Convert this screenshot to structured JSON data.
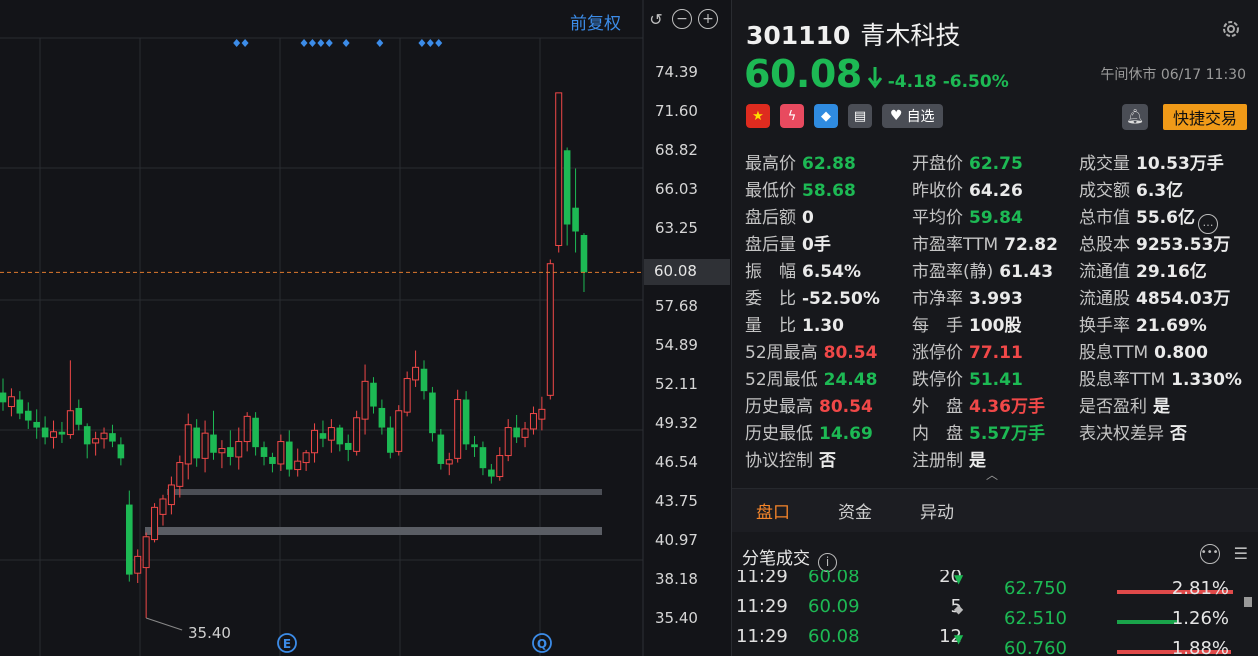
{
  "chart": {
    "fq_label": "前复权",
    "y_ticks": [
      "74.39",
      "71.60",
      "68.82",
      "66.03",
      "63.25",
      "60.08",
      "57.68",
      "54.89",
      "52.11",
      "49.32",
      "46.54",
      "43.75",
      "40.97",
      "38.18",
      "35.40"
    ],
    "current_price_label": "60.08",
    "low_annotation": "35.40",
    "marker_e": "E",
    "marker_q": "Q",
    "colors": {
      "up": "#f04848",
      "down": "#1db954",
      "grid": "#2a2c31",
      "current_line": "#e07a2e",
      "signal": "#3c8ce8"
    },
    "candles": [
      {
        "o": 51.5,
        "h": 52.5,
        "l": 50.2,
        "c": 50.8
      },
      {
        "o": 50.5,
        "h": 51.8,
        "l": 49.8,
        "c": 51.2
      },
      {
        "o": 51.0,
        "h": 51.6,
        "l": 49.6,
        "c": 50.0
      },
      {
        "o": 50.2,
        "h": 50.8,
        "l": 48.9,
        "c": 49.5
      },
      {
        "o": 49.4,
        "h": 50.3,
        "l": 48.2,
        "c": 49.0
      },
      {
        "o": 49.0,
        "h": 49.8,
        "l": 47.8,
        "c": 48.3
      },
      {
        "o": 48.3,
        "h": 49.5,
        "l": 47.5,
        "c": 48.7
      },
      {
        "o": 48.7,
        "h": 49.4,
        "l": 47.9,
        "c": 48.5
      },
      {
        "o": 48.5,
        "h": 53.8,
        "l": 48.2,
        "c": 50.2
      },
      {
        "o": 50.4,
        "h": 51.0,
        "l": 48.8,
        "c": 49.2
      },
      {
        "o": 49.1,
        "h": 49.3,
        "l": 46.8,
        "c": 47.8
      },
      {
        "o": 47.9,
        "h": 48.7,
        "l": 47.0,
        "c": 48.2
      },
      {
        "o": 48.2,
        "h": 49.0,
        "l": 47.5,
        "c": 48.6
      },
      {
        "o": 48.6,
        "h": 49.2,
        "l": 47.6,
        "c": 48.0
      },
      {
        "o": 47.8,
        "h": 48.3,
        "l": 46.3,
        "c": 46.8
      },
      {
        "o": 43.5,
        "h": 44.5,
        "l": 38.0,
        "c": 38.5
      },
      {
        "o": 38.6,
        "h": 40.3,
        "l": 37.9,
        "c": 39.8
      },
      {
        "o": 39.0,
        "h": 41.5,
        "l": 35.4,
        "c": 41.2
      },
      {
        "o": 41.0,
        "h": 43.6,
        "l": 40.8,
        "c": 43.3
      },
      {
        "o": 42.8,
        "h": 44.2,
        "l": 42.0,
        "c": 43.9
      },
      {
        "o": 43.5,
        "h": 45.5,
        "l": 42.8,
        "c": 44.9
      },
      {
        "o": 44.8,
        "h": 47.0,
        "l": 44.0,
        "c": 46.5
      },
      {
        "o": 46.4,
        "h": 50.0,
        "l": 45.3,
        "c": 49.2
      },
      {
        "o": 49.0,
        "h": 49.6,
        "l": 46.2,
        "c": 46.8
      },
      {
        "o": 46.8,
        "h": 49.5,
        "l": 45.8,
        "c": 48.6
      },
      {
        "o": 48.5,
        "h": 50.2,
        "l": 46.7,
        "c": 47.2
      },
      {
        "o": 47.2,
        "h": 48.1,
        "l": 46.1,
        "c": 47.5
      },
      {
        "o": 47.6,
        "h": 48.8,
        "l": 46.3,
        "c": 46.9
      },
      {
        "o": 46.9,
        "h": 49.0,
        "l": 46.0,
        "c": 48.0
      },
      {
        "o": 48.0,
        "h": 50.1,
        "l": 47.3,
        "c": 49.8
      },
      {
        "o": 49.7,
        "h": 50.1,
        "l": 47.0,
        "c": 47.6
      },
      {
        "o": 47.6,
        "h": 48.0,
        "l": 46.3,
        "c": 46.9
      },
      {
        "o": 46.9,
        "h": 47.2,
        "l": 45.8,
        "c": 46.4
      },
      {
        "o": 46.4,
        "h": 48.5,
        "l": 45.9,
        "c": 48.0
      },
      {
        "o": 48.0,
        "h": 48.8,
        "l": 45.5,
        "c": 46.0
      },
      {
        "o": 46.0,
        "h": 47.5,
        "l": 45.5,
        "c": 46.6
      },
      {
        "o": 46.5,
        "h": 47.4,
        "l": 45.9,
        "c": 47.2
      },
      {
        "o": 47.2,
        "h": 49.3,
        "l": 46.5,
        "c": 48.8
      },
      {
        "o": 48.6,
        "h": 49.5,
        "l": 47.6,
        "c": 48.2
      },
      {
        "o": 48.1,
        "h": 49.6,
        "l": 47.2,
        "c": 49.0
      },
      {
        "o": 49.0,
        "h": 49.2,
        "l": 47.3,
        "c": 47.8
      },
      {
        "o": 47.9,
        "h": 48.5,
        "l": 46.6,
        "c": 47.4
      },
      {
        "o": 47.3,
        "h": 50.2,
        "l": 47.0,
        "c": 49.7
      },
      {
        "o": 49.6,
        "h": 53.5,
        "l": 48.5,
        "c": 52.3
      },
      {
        "o": 52.2,
        "h": 52.6,
        "l": 50.0,
        "c": 50.5
      },
      {
        "o": 50.4,
        "h": 51.0,
        "l": 48.5,
        "c": 49.0
      },
      {
        "o": 49.0,
        "h": 49.8,
        "l": 46.8,
        "c": 47.2
      },
      {
        "o": 47.3,
        "h": 50.6,
        "l": 47.0,
        "c": 50.2
      },
      {
        "o": 50.1,
        "h": 53.0,
        "l": 49.8,
        "c": 52.5
      },
      {
        "o": 52.4,
        "h": 54.5,
        "l": 51.9,
        "c": 53.3
      },
      {
        "o": 53.2,
        "h": 53.8,
        "l": 51.0,
        "c": 51.6
      },
      {
        "o": 51.5,
        "h": 51.9,
        "l": 48.0,
        "c": 48.6
      },
      {
        "o": 48.5,
        "h": 48.9,
        "l": 46.0,
        "c": 46.4
      },
      {
        "o": 46.4,
        "h": 47.2,
        "l": 45.6,
        "c": 46.7
      },
      {
        "o": 46.8,
        "h": 51.7,
        "l": 46.5,
        "c": 51.0
      },
      {
        "o": 51.0,
        "h": 51.6,
        "l": 47.4,
        "c": 47.8
      },
      {
        "o": 47.8,
        "h": 48.4,
        "l": 46.9,
        "c": 47.6
      },
      {
        "o": 47.6,
        "h": 48.0,
        "l": 45.6,
        "c": 46.1
      },
      {
        "o": 46.0,
        "h": 46.4,
        "l": 45.0,
        "c": 45.5
      },
      {
        "o": 45.5,
        "h": 47.6,
        "l": 45.2,
        "c": 47.0
      },
      {
        "o": 47.0,
        "h": 49.6,
        "l": 46.6,
        "c": 49.0
      },
      {
        "o": 49.0,
        "h": 49.9,
        "l": 47.9,
        "c": 48.3
      },
      {
        "o": 48.3,
        "h": 49.4,
        "l": 47.6,
        "c": 48.9
      },
      {
        "o": 48.9,
        "h": 50.5,
        "l": 48.5,
        "c": 50.0
      },
      {
        "o": 49.6,
        "h": 51.2,
        "l": 48.8,
        "c": 50.3
      },
      {
        "o": 51.3,
        "h": 61.0,
        "l": 51.0,
        "c": 60.7
      },
      {
        "o": 62.0,
        "h": 72.9,
        "l": 61.5,
        "c": 72.9
      },
      {
        "o": 68.8,
        "h": 69.0,
        "l": 62.0,
        "c": 63.5
      },
      {
        "o": 64.7,
        "h": 67.5,
        "l": 61.5,
        "c": 63.0
      },
      {
        "o": 62.75,
        "h": 62.88,
        "l": 58.68,
        "c": 60.08
      }
    ],
    "signal_markers": [
      23,
      24,
      31,
      32,
      33,
      34,
      36,
      40,
      45,
      46,
      47
    ]
  },
  "stock": {
    "code": "301110",
    "name": "青木科技",
    "price": "60.08",
    "change": "-4.18",
    "change_pct": "-6.50%",
    "status": "午间休市 06/17 11:30",
    "fav_label": "自选",
    "quick_trade": "快捷交易",
    "stats": [
      {
        "label": "最高价",
        "value": "62.88",
        "color": "green"
      },
      {
        "label": "开盘价",
        "value": "62.75",
        "color": "green"
      },
      {
        "label": "成交量",
        "value": "10.53万手",
        "color": ""
      },
      {
        "label": "最低价",
        "value": "58.68",
        "color": "green"
      },
      {
        "label": "昨收价",
        "value": "64.26",
        "color": ""
      },
      {
        "label": "成交额",
        "value": "6.3亿",
        "color": ""
      },
      {
        "label": "盘后额",
        "value": "0",
        "color": ""
      },
      {
        "label": "平均价",
        "value": "59.84",
        "color": "green"
      },
      {
        "label": "总市值",
        "value": "55.6亿",
        "color": ""
      },
      {
        "label": "盘后量",
        "value": "0手",
        "color": ""
      },
      {
        "label": "市盈率TTM",
        "value": "72.82",
        "color": ""
      },
      {
        "label": "总股本",
        "value": "9253.53万",
        "color": ""
      },
      {
        "label": "振　幅",
        "value": "6.54%",
        "color": ""
      },
      {
        "label": "市盈率(静)",
        "value": "61.43",
        "color": ""
      },
      {
        "label": "流通值",
        "value": "29.16亿",
        "color": ""
      },
      {
        "label": "委　比",
        "value": "-52.50%",
        "color": ""
      },
      {
        "label": "市净率",
        "value": "3.993",
        "color": ""
      },
      {
        "label": "流通股",
        "value": "4854.03万",
        "color": ""
      },
      {
        "label": "量　比",
        "value": "1.30",
        "color": ""
      },
      {
        "label": "每　手",
        "value": "100股",
        "color": ""
      },
      {
        "label": "换手率",
        "value": "21.69%",
        "color": ""
      },
      {
        "label": "52周最高",
        "value": "80.54",
        "color": "red"
      },
      {
        "label": "涨停价",
        "value": "77.11",
        "color": "red"
      },
      {
        "label": "股息TTM",
        "value": "0.800",
        "color": ""
      },
      {
        "label": "52周最低",
        "value": "24.48",
        "color": "green"
      },
      {
        "label": "跌停价",
        "value": "51.41",
        "color": "green"
      },
      {
        "label": "股息率TTM",
        "value": "1.330%",
        "color": ""
      },
      {
        "label": "历史最高",
        "value": "80.54",
        "color": "red"
      },
      {
        "label": "外　盘",
        "value": "4.36万手",
        "color": "red"
      },
      {
        "label": "是否盈利",
        "value": "是",
        "color": ""
      },
      {
        "label": "历史最低",
        "value": "14.69",
        "color": "green"
      },
      {
        "label": "内　盘",
        "value": "5.57万手",
        "color": "green"
      },
      {
        "label": "表决权差异",
        "value": "否",
        "color": ""
      },
      {
        "label": "协议控制",
        "value": "否",
        "color": ""
      },
      {
        "label": "注册制",
        "value": "是",
        "color": ""
      }
    ],
    "more_icon": "…"
  },
  "tabs": [
    {
      "label": "盘口",
      "active": true
    },
    {
      "label": "资金",
      "active": false
    },
    {
      "label": "异动",
      "active": false
    }
  ],
  "trades": {
    "title": "分笔成交",
    "info_icon": "i",
    "rows": [
      {
        "time": "11:29",
        "price": "60.08",
        "vol": "20",
        "dir": "down"
      },
      {
        "time": "11:29",
        "price": "60.09",
        "vol": "5",
        "dir": "neu"
      },
      {
        "time": "11:29",
        "price": "60.08",
        "vol": "12",
        "dir": "down"
      }
    ]
  },
  "levels": [
    {
      "price": "62.750",
      "pct": "2.81%",
      "share": 0.97,
      "color": "#e04a4a"
    },
    {
      "price": "62.510",
      "pct": "1.26%",
      "share": 0.5,
      "color": "#1aa34a"
    },
    {
      "price": "60.760",
      "pct": "1.88%",
      "share": 0.95,
      "color": "#e04a4a"
    }
  ]
}
